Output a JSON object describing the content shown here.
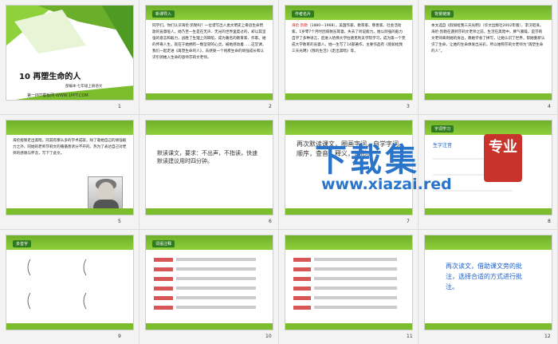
{
  "slides": [
    {
      "number": "1",
      "title": "10 再塑生命的人",
      "subtitle": "部编本·七年级上册语文",
      "footer": "第一PPT模板网-WWW.1PPT.COM"
    },
    {
      "number": "2",
      "tag": "新课导入",
      "text": "同学们，你们认识海伦·凯勒吗？一位谱写出人类文明史上奇迹生命赞歌的盲聋哑人。她乃至一生是在无声、无光的世界里度过的，却以其坚强的意志和毅力，战胜了生理上的缺陷，成为著名的教育家、作家。她的传奇人生，就在于她拥有一颗坚韧的心灵，被她感动着……这堂课，我们一起走进《再塑生命的人》，去感受一个残疾生命的顽强成长和认识引领她入生命的恩师莎莉文老师。"
    },
    {
      "number": "3",
      "tag": "作者名片",
      "name": "海伦·凯勒",
      "text": "（1880—1968），美国作家、教育家、慈善家、社会活动家。1岁零7个月时因病致盲耳聋，失去了听说能力。她以顽强的毅力自学了多种语言，后进入哈佛大学拉德克利夫学院学习，成为第一个完成大学教育的盲聋人。她一生写了14部著作，主要作品有《假如给我三天光明》《我的生活》《走出黑暗》等。"
    },
    {
      "number": "4",
      "tag": "背景链接",
      "text": "本文选自《假如给我三天光明》（华文出版社2002年版），李汉昭译。海伦·凯勒在遇到莎莉文老师之前，生活在黑暗中，脾气暴躁，是莎莉文老师来到她的身边，教她学会了拼写，让她认识了世界，帮她重新认识了生命，让她的生命焕发出光彩，所以她称莎莉文老师为“再塑生命的人”。"
    },
    {
      "number": "5",
      "text": "海伦能够走出黑暗，同其有那么多的学术成就，除了靠她自己的顽强毅力之外，同她的老师莎莉文的循循善诱分不开的。热为了表达自己对老师的感谢与怀念，写下了此文。"
    },
    {
      "number": "6",
      "text": "默读课文，要求：不出声，不指读，快速默读建议用时四分钟。"
    },
    {
      "number": "7",
      "text": "再次默读课文，圈画字词，自学字词。顺序，查音，释义，记形。"
    },
    {
      "number": "8",
      "tag": "字词学习",
      "label": "生字注音"
    },
    {
      "number": "9",
      "tag": "多音字"
    },
    {
      "number": "10",
      "tag": "词语注释"
    },
    {
      "number": "11",
      "tag": "词语"
    },
    {
      "number": "12",
      "text": "再次读文，借助课文旁的批注，选择合适的方式进行批注。"
    }
  ],
  "watermark": {
    "big": "下载集",
    "seal": "专业",
    "url": "www.xiazai.red"
  },
  "colors": {
    "green": "#7cbd2e",
    "dark_green": "#2f7c1e",
    "blue_text": "#1e5ec8",
    "red": "#cc1d1d",
    "watermark_blue": "#2a74c9",
    "seal_red": "#c8342b"
  }
}
